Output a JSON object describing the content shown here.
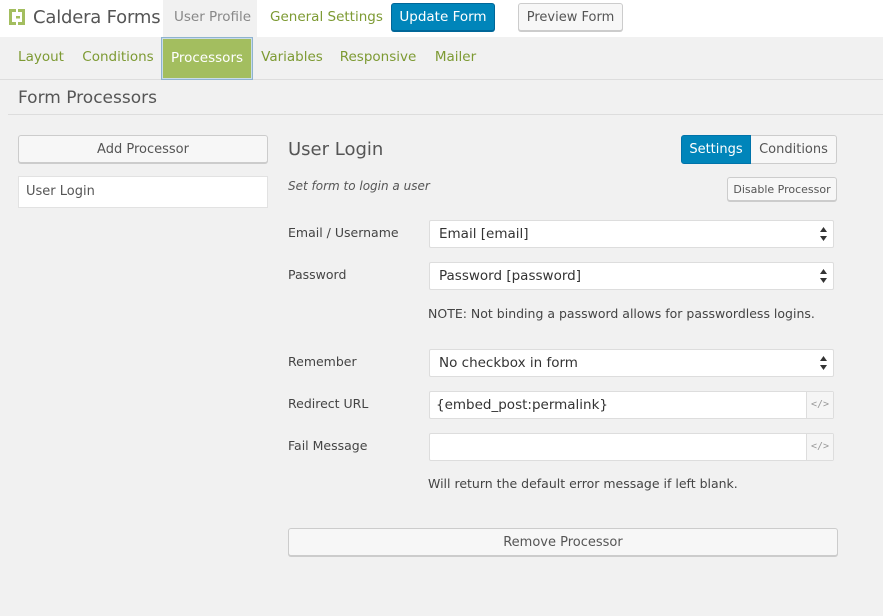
{
  "header": {
    "logo_text": "Caldera Forms",
    "current_form": "User Profile",
    "general_settings": "General Settings",
    "update_button": "Update Form",
    "preview_button": "Preview Form"
  },
  "tabs": [
    {
      "label": "Layout"
    },
    {
      "label": "Conditions"
    },
    {
      "label": "Processors"
    },
    {
      "label": "Variables"
    },
    {
      "label": "Responsive"
    },
    {
      "label": "Mailer"
    }
  ],
  "section": {
    "title": "Form Processors"
  },
  "sidebar": {
    "add_button": "Add Processor",
    "items": [
      {
        "label": "User Login"
      }
    ]
  },
  "processor": {
    "title": "User Login",
    "description": "Set form to login a user",
    "settings_tab": "Settings",
    "conditions_tab": "Conditions",
    "disable_button": "Disable Processor",
    "fields": {
      "email": {
        "label": "Email / Username",
        "value": "Email [email]"
      },
      "password": {
        "label": "Password",
        "value": "Password [password]"
      },
      "password_note": "NOTE: Not binding a password allows for passwordless logins.",
      "remember": {
        "label": "Remember",
        "value": "No checkbox in form"
      },
      "redirect": {
        "label": "Redirect URL",
        "value": "{embed_post:permalink}",
        "tag_icon": "</>"
      },
      "fail": {
        "label": "Fail Message",
        "value": "",
        "tag_icon": "</>"
      },
      "fail_note": "Will return the default error message if left blank."
    },
    "remove_button": "Remove Processor"
  },
  "colors": {
    "primary": "#0085ba",
    "accent_green": "#7d9a33",
    "active_tab": "#a3be5f"
  }
}
